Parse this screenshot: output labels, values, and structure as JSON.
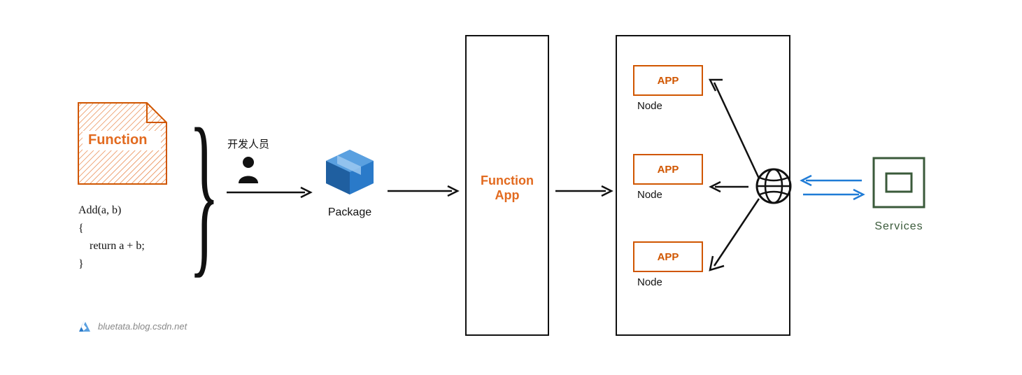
{
  "function_block": {
    "title": "Function",
    "code_line1": "Add(a, b)",
    "code_line2": "{",
    "code_line3": "    return a + b;",
    "code_line4": "}"
  },
  "developer_label": "开发人员",
  "package_label": "Package",
  "function_app_label_line1": "Function",
  "function_app_label_line2": "App",
  "nodes": [
    {
      "app_label": "APP",
      "node_label": "Node"
    },
    {
      "app_label": "APP",
      "node_label": "Node"
    },
    {
      "app_label": "APP",
      "node_label": "Node"
    }
  ],
  "services_label": "Services",
  "watermark": "bluetata.blog.csdn.net",
  "colors": {
    "orange": "#e26a1f",
    "deep_orange": "#d05600",
    "blue": "#1f7bd6",
    "dark_green": "#3a5a3a"
  }
}
